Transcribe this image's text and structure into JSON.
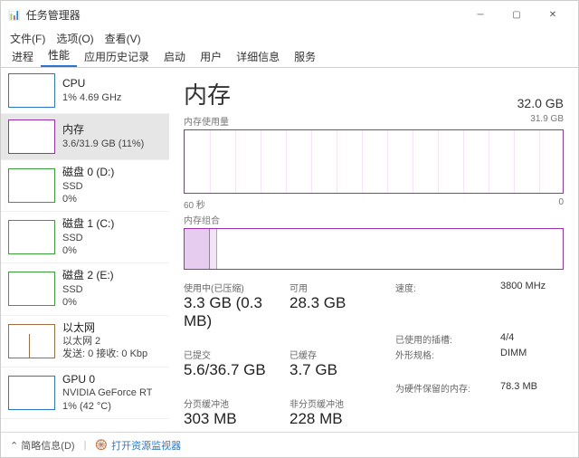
{
  "window": {
    "title": "任务管理器",
    "icon": "📊"
  },
  "menus": {
    "file": "文件(F)",
    "options": "选项(O)",
    "view": "查看(V)"
  },
  "tabs": {
    "processes": "进程",
    "performance": "性能",
    "history": "应用历史记录",
    "startup": "启动",
    "users": "用户",
    "details": "详细信息",
    "services": "服务"
  },
  "sidebar": [
    {
      "name": "CPU",
      "sub1": "1%  4.69 GHz",
      "sub2": "",
      "kind": "cpu"
    },
    {
      "name": "内存",
      "sub1": "3.6/31.9 GB (11%)",
      "sub2": "",
      "kind": "mem"
    },
    {
      "name": "磁盘 0 (D:)",
      "sub1": "SSD",
      "sub2": "0%",
      "kind": "disk"
    },
    {
      "name": "磁盘 1 (C:)",
      "sub1": "SSD",
      "sub2": "0%",
      "kind": "disk"
    },
    {
      "name": "磁盘 2 (E:)",
      "sub1": "SSD",
      "sub2": "0%",
      "kind": "disk"
    },
    {
      "name": "以太网",
      "sub1": "以太网 2",
      "sub2": "发送: 0 接收: 0 Kbp",
      "kind": "eth"
    },
    {
      "name": "GPU 0",
      "sub1": "NVIDIA GeForce RT",
      "sub2": "1%  (42 °C)",
      "kind": "gpu"
    }
  ],
  "main": {
    "title": "内存",
    "total": "32.0 GB",
    "usageLabel": "内存使用量",
    "maxLabel": "31.9 GB",
    "xLeft": "60 秒",
    "xRight": "0",
    "compLabel": "内存组合",
    "stats": {
      "inUseLabel": "使用中(已压缩)",
      "inUse": "3.3 GB (0.3 MB)",
      "availLabel": "可用",
      "avail": "28.3 GB",
      "speedLabel": "速度:",
      "speed": "3800 MHz",
      "slotsLabel": "已使用的插槽:",
      "slots": "4/4",
      "committedLabel": "已提交",
      "committed": "5.6/36.7 GB",
      "cachedLabel": "已缓存",
      "cached": "3.7 GB",
      "formLabel": "外形规格:",
      "form": "DIMM",
      "hwReservedLabel": "为硬件保留的内存:",
      "hwReserved": "78.3 MB",
      "pagedLabel": "分页缓冲池",
      "paged": "303 MB",
      "nonpagedLabel": "非分页缓冲池",
      "nonpaged": "228 MB"
    }
  },
  "footer": {
    "fewer": "简略信息(D)",
    "resmon": "打开资源监视器"
  }
}
